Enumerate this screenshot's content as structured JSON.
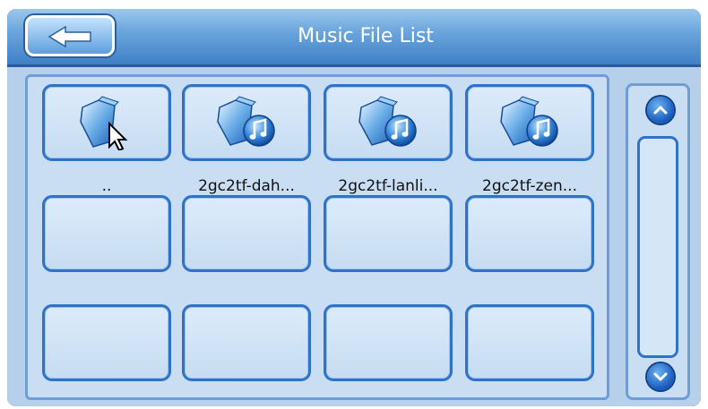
{
  "header": {
    "title": "Music File List",
    "back_icon": "arrow-left-icon"
  },
  "grid": {
    "items": [
      {
        "label": "..",
        "icon": "parent-folder-icon"
      },
      {
        "label": "2gc2tf-dah...",
        "icon": "music-folder-icon"
      },
      {
        "label": "2gc2tf-lanli...",
        "icon": "music-folder-icon"
      },
      {
        "label": "2gc2tf-zen...",
        "icon": "music-folder-icon"
      }
    ]
  },
  "scroll": {
    "up_icon": "chevron-up-icon",
    "down_icon": "chevron-down-icon"
  },
  "colors": {
    "header": "#5b96d6",
    "panel": "#c9ddf3",
    "cell_border": "#2f73c9"
  }
}
